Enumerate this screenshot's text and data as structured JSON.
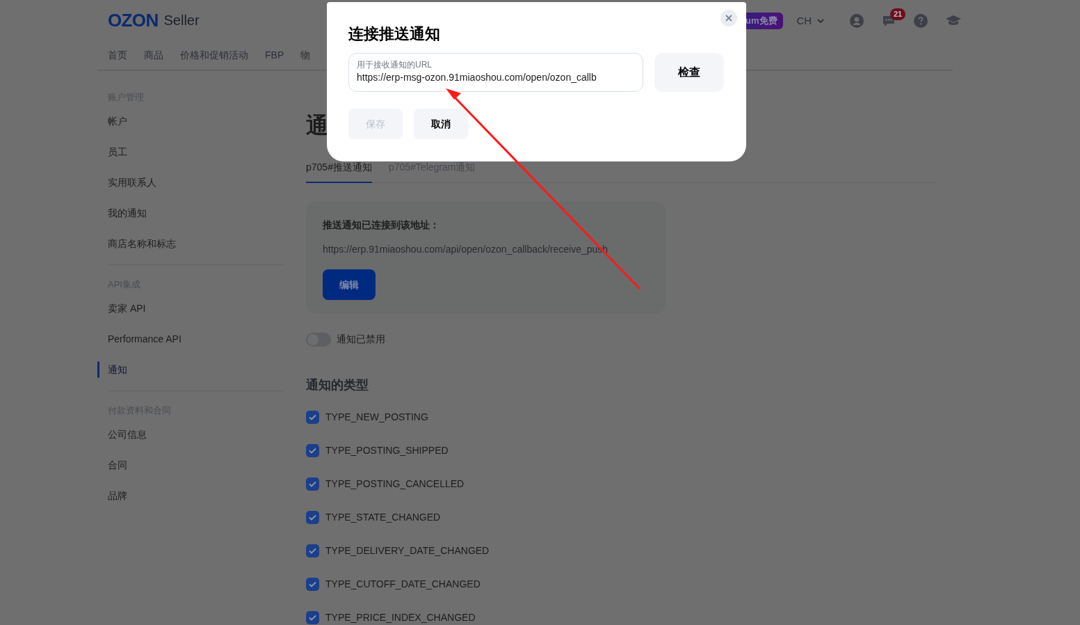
{
  "header": {
    "logo": "OZON",
    "logo_suffix": "Seller",
    "nav": [
      {
        "label": "首页",
        "selected": false
      },
      {
        "label": "商品",
        "selected": false
      },
      {
        "label": "价格和促销活动",
        "selected": false
      },
      {
        "label": "FBP",
        "selected": false
      },
      {
        "label": "物",
        "selected": false
      }
    ],
    "promo": "um免费",
    "language": "CH",
    "chat_count": "21"
  },
  "sidebar": [
    {
      "title": "账户管理",
      "items": [
        {
          "label": "帐户",
          "selected": false
        },
        {
          "label": "员工",
          "selected": false
        },
        {
          "label": "实用联系人",
          "selected": false
        },
        {
          "label": "我的通知",
          "selected": false
        },
        {
          "label": "商店名称和标志",
          "selected": false
        }
      ]
    },
    {
      "title": "API集成",
      "items": [
        {
          "label": "卖家 API",
          "selected": false
        },
        {
          "label": "Performance API",
          "selected": false
        },
        {
          "label": "通知",
          "selected": true
        }
      ]
    },
    {
      "title": "付款资料和合同",
      "items": [
        {
          "label": "公司信息",
          "selected": false
        },
        {
          "label": "合同",
          "selected": false
        },
        {
          "label": "品牌",
          "selected": false
        }
      ]
    }
  ],
  "page_title": "通",
  "tabs": [
    {
      "label": "p705#推送通知",
      "selected": true
    },
    {
      "label": "p705#Telegram通知",
      "selected": false
    }
  ],
  "card": {
    "title": "推送通知已连接到该地址：",
    "url": "https://erp.91miaoshou.com/api/open/ozon_callback/receive_push",
    "button": "编辑"
  },
  "toggle": {
    "label": "通知已禁用",
    "on": false
  },
  "types_title": "通知的类型",
  "types": [
    {
      "label": "TYPE_NEW_POSTING",
      "checked": true
    },
    {
      "label": "TYPE_POSTING_SHIPPED",
      "checked": true
    },
    {
      "label": "TYPE_POSTING_CANCELLED",
      "checked": true
    },
    {
      "label": "TYPE_STATE_CHANGED",
      "checked": true
    },
    {
      "label": "TYPE_DELIVERY_DATE_CHANGED",
      "checked": true
    },
    {
      "label": "TYPE_CUTOFF_DATE_CHANGED",
      "checked": true
    },
    {
      "label": "TYPE_PRICE_INDEX_CHANGED",
      "checked": true
    }
  ],
  "modal": {
    "title": "连接推送通知",
    "field_label": "用于接收通知的URL",
    "field_value": "https://erp-msg-ozon.91miaoshou.com/open/ozon_callb",
    "check_button": "检查",
    "save": {
      "label": "保存",
      "disabled": true
    },
    "cancel": "取消"
  }
}
